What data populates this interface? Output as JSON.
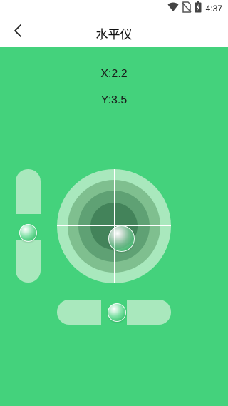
{
  "status_bar": {
    "time": "4:37",
    "icons": [
      "wifi-icon",
      "no-sim-icon",
      "battery-charging-icon"
    ]
  },
  "header": {
    "title": "水平仪",
    "back_icon": "chevron-left-icon"
  },
  "readings": {
    "x": "X:2.2",
    "y": "Y:3.5"
  },
  "colors": {
    "background": "#44d27c",
    "track": "#a9e8bd",
    "ring_1": "#a9e8bd",
    "ring_2": "#7fbf8f",
    "ring_3": "#5fa174",
    "ring_4": "#43835a",
    "crosshair": "#ffffff"
  }
}
